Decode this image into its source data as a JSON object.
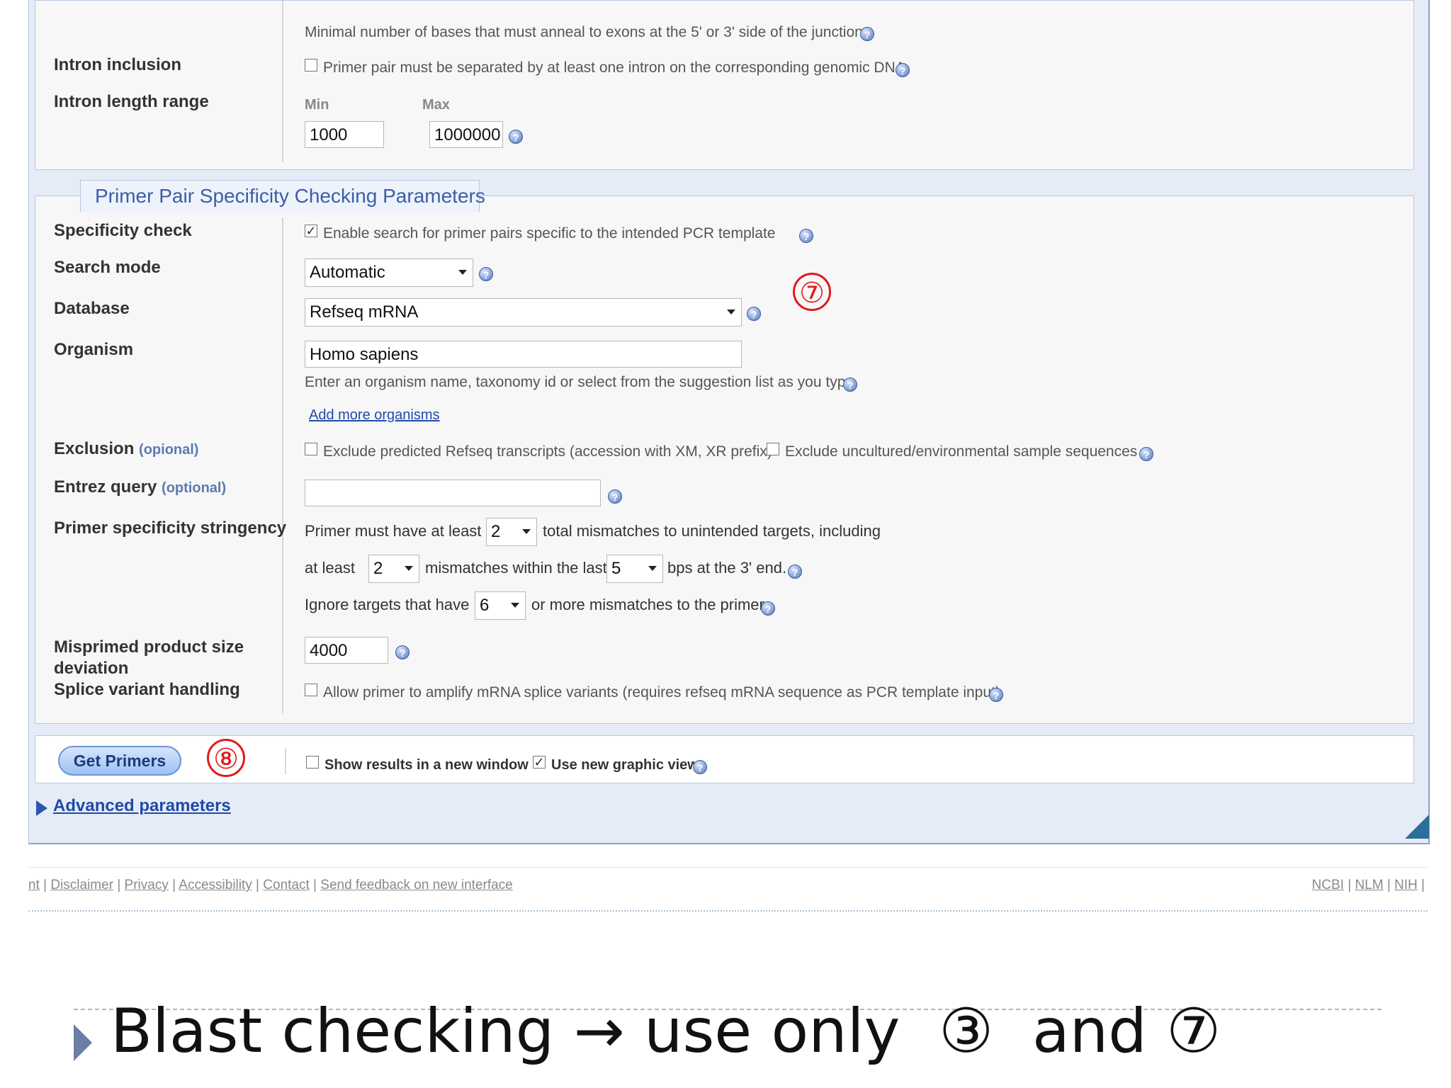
{
  "top": {
    "junction_note": "Minimal number of bases that must anneal to exons at the 5' or 3' side of the junction",
    "intron_inclusion_label": "Intron inclusion",
    "intron_inclusion_text": "Primer pair must be separated by at least one intron on the corresponding genomic DNA",
    "intron_length_label": "Intron length range",
    "min_label": "Min",
    "max_label": "Max",
    "min_value": "1000",
    "max_value": "1000000"
  },
  "specificity": {
    "legend": "Primer Pair Specificity Checking Parameters",
    "specificity_check_label": "Specificity check",
    "specificity_check_text": "Enable search for primer pairs specific to the intended PCR template",
    "search_mode_label": "Search mode",
    "search_mode_value": "Automatic",
    "database_label": "Database",
    "database_value": "Refseq mRNA",
    "organism_label": "Organism",
    "organism_value": "Homo sapiens",
    "organism_hint": "Enter an organism name, taxonomy id or select from the suggestion list as you type.",
    "add_more_organisms": "Add more organisms",
    "exclusion_label": "Exclusion",
    "exclusion_opt": "(opional)",
    "exclude_predicted": "Exclude predicted Refseq transcripts (accession with XM, XR prefix)",
    "exclude_uncultured": "Exclude uncultured/environmental sample sequences",
    "entrez_label": "Entrez query",
    "entrez_opt": "(optional)",
    "stringency_label": "Primer specificity stringency",
    "stringency_l1_a": "Primer must have at least",
    "stringency_l1_val": "2",
    "stringency_l1_b": "total mismatches to unintended targets, including",
    "stringency_l2_a": "at least",
    "stringency_l2_val": "2",
    "stringency_l2_b": "mismatches within the last",
    "stringency_l2_val2": "5",
    "stringency_l2_c": "bps at the 3' end.",
    "stringency_l3_a": "Ignore targets that have",
    "stringency_l3_val": "6",
    "stringency_l3_b": "or more mismatches to the primer.",
    "misprimed_label_1": "Misprimed product size",
    "misprimed_label_2": "deviation",
    "misprimed_value": "4000",
    "splice_label": "Splice variant handling",
    "splice_text": "Allow primer to amplify mRNA splice variants (requires refseq mRNA sequence as PCR template input)"
  },
  "actions": {
    "get_primers": "Get Primers",
    "show_new_window": "Show results in a new window",
    "use_graphic_view": "Use new graphic view",
    "advanced": "Advanced parameters"
  },
  "annotations": {
    "seven": "⑦",
    "eight": "⑧"
  },
  "footer": {
    "left": [
      "nt",
      "Disclaimer",
      "Privacy",
      "Accessibility",
      "Contact",
      "Send feedback on new interface"
    ],
    "right": [
      "NCBI",
      "NLM",
      "NIH"
    ]
  },
  "slide": {
    "bullet_text_a": "Blast checking",
    "arrow": "→",
    "bullet_text_b": "use only",
    "three": "③",
    "and": "and",
    "seven": "⑦"
  },
  "colors": {
    "accent": "#1f4aa8",
    "annotation": "#e01b1b",
    "panel_bg": "#e6ecf7"
  }
}
